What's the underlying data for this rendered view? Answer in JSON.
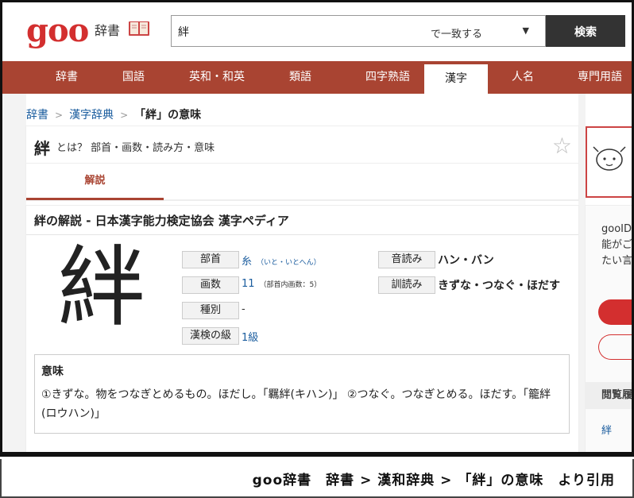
{
  "header": {
    "logo": "goo",
    "logo_sub": "辞書",
    "search_value": "絆",
    "match_mode": "で一致する",
    "search_button": "検索"
  },
  "nav": {
    "items": [
      "辞書",
      "国語",
      "英和・和英",
      "類語",
      "四字熟語",
      "漢字",
      "人名",
      "専門用語"
    ],
    "active": "漢字"
  },
  "breadcrumb": {
    "items": [
      "辞書",
      "漢字辞典"
    ],
    "current": "「絆」の意味"
  },
  "title": {
    "kanji": "絆",
    "desc": "とは？ 部首・画数・読み方・意味",
    "tab": "解説"
  },
  "entry": {
    "section_title": "絆の解説 - 日本漢字能力検定協会 漢字ペディア",
    "kanji": "絆",
    "radical_label": "部首",
    "radical": "糸",
    "radical_note": "（いと・いとへん）",
    "strokes_label": "画数",
    "strokes": "11",
    "strokes_note": "（部首内画数：5）",
    "type_label": "種別",
    "type": "-",
    "kanken_label": "漢検の級",
    "kanken": "1級",
    "onyomi_label": "音読み",
    "onyomi": "ハン・バン",
    "kunyomi_label": "訓読み",
    "kunyomi": "きずな・つなぐ・ほだす",
    "meaning_heading": "意味",
    "meaning_text": "①きずな。物をつなぎとめるもの。ほだし。「羈絆(キハン)」 ②つなぐ。つなぎとめる。ほだす。「籠絆(ロウハン)」"
  },
  "sidebar": {
    "text": [
      "gooID",
      "能がご",
      "たい言"
    ],
    "history_label": "閲覧履",
    "history_item": "絆"
  },
  "caption": "goo辞書　辞書 > 漢和辞典 > 「絆」の意味　より引用"
}
